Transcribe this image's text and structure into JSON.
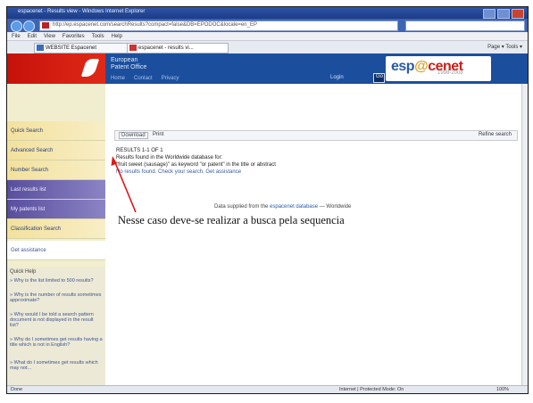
{
  "browser": {
    "title": "espacenet - Results view - Windows Internet Explorer",
    "url": "http://ep.espacenet.com/searchResults?compact=false&DB=EPODOC&locale=en_EP",
    "menu": [
      "File",
      "Edit",
      "View",
      "Favorites",
      "Tools",
      "Help"
    ],
    "tabs": [
      "WEBSITE Espacenet",
      "espacenet - results vi..."
    ],
    "tools_label": "Page ▾  Tools ▾"
  },
  "header": {
    "office_line1": "European",
    "office_line2": "Patent Office",
    "subnav": [
      "Home",
      "Contact",
      "Privacy"
    ],
    "login_label": "Login",
    "login_btn": "Go",
    "logo_esp": "esp",
    "logo_at": "@",
    "logo_cenet": "cenet",
    "logo_years": "1998-2008"
  },
  "sidebar": {
    "items": [
      "Quick Search",
      "Advanced Search",
      "Number Search",
      "Last results list",
      "My patents list",
      "Classification Search",
      "Get assistance"
    ],
    "help_title": "Quick Help",
    "help_links": [
      "» Why is the list limited to 500 results?",
      "» Why is the number of results sometimes approximate?",
      "» Why would I be told a search pattern document is not displayed in the result list?",
      "» Why do I sometimes get results having a title which is not in English?",
      "» What do I sometimes get results which may not..."
    ]
  },
  "content": {
    "toolbar": {
      "download": "Download",
      "print": "Print",
      "refine": "Refine search"
    },
    "results_title": "RESULTS 1-1 OF 1",
    "results_line1": "Results found in the Worldwide database for:",
    "results_line2": "\"fruit sweet (sausage)\" as keyword \"or patent\" in the title or abstract",
    "results_line3": "No results found. Check your search. Get assistance",
    "supplied_prefix": "Data supplied from the",
    "supplied_link": "espacenet database",
    "supplied_suffix": "— Worldwide"
  },
  "status": {
    "left": "Done",
    "zone": "Internet | Protected Mode: On",
    "zoom": "100%"
  },
  "annotation": {
    "text": "Nesse caso deve-se realizar a busca pela sequencia",
    "arrow_color": "#e01414"
  }
}
